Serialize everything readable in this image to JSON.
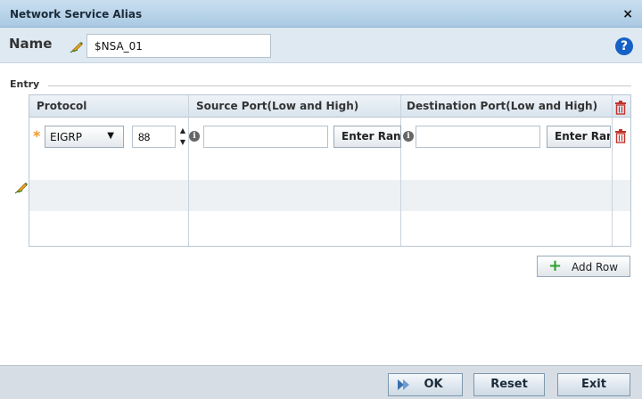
{
  "window": {
    "title": "Network Service Alias",
    "close_glyph": "×"
  },
  "name_section": {
    "label": "Name",
    "value": "$NSA_01",
    "help_glyph": "?"
  },
  "entry": {
    "legend": "Entry",
    "columns": [
      "Protocol",
      "Source Port(Low and High)",
      "Destination Port(Low and High)"
    ],
    "row": {
      "protocol": "EIGRP",
      "protocol_number": "88",
      "source_port": "",
      "source_range_button": "Enter Range",
      "destination_port": "",
      "destination_range_button": "Enter Range"
    }
  },
  "add_row_label": "Add Row",
  "footer": {
    "ok_label": "OK",
    "reset_label": "Reset",
    "exit_label": "Exit"
  },
  "icons": {
    "edit": "pencil-icon",
    "delete": "trash-icon",
    "help": "help-icon",
    "info": "info-icon",
    "add": "plus-icon",
    "ok": "ok-arrows-icon"
  },
  "colors": {
    "titlebar": "#a9c9e3",
    "accent": "#1561c7",
    "delete": "#c0322b",
    "add": "#2ba12b",
    "required": "#f29b1f"
  }
}
